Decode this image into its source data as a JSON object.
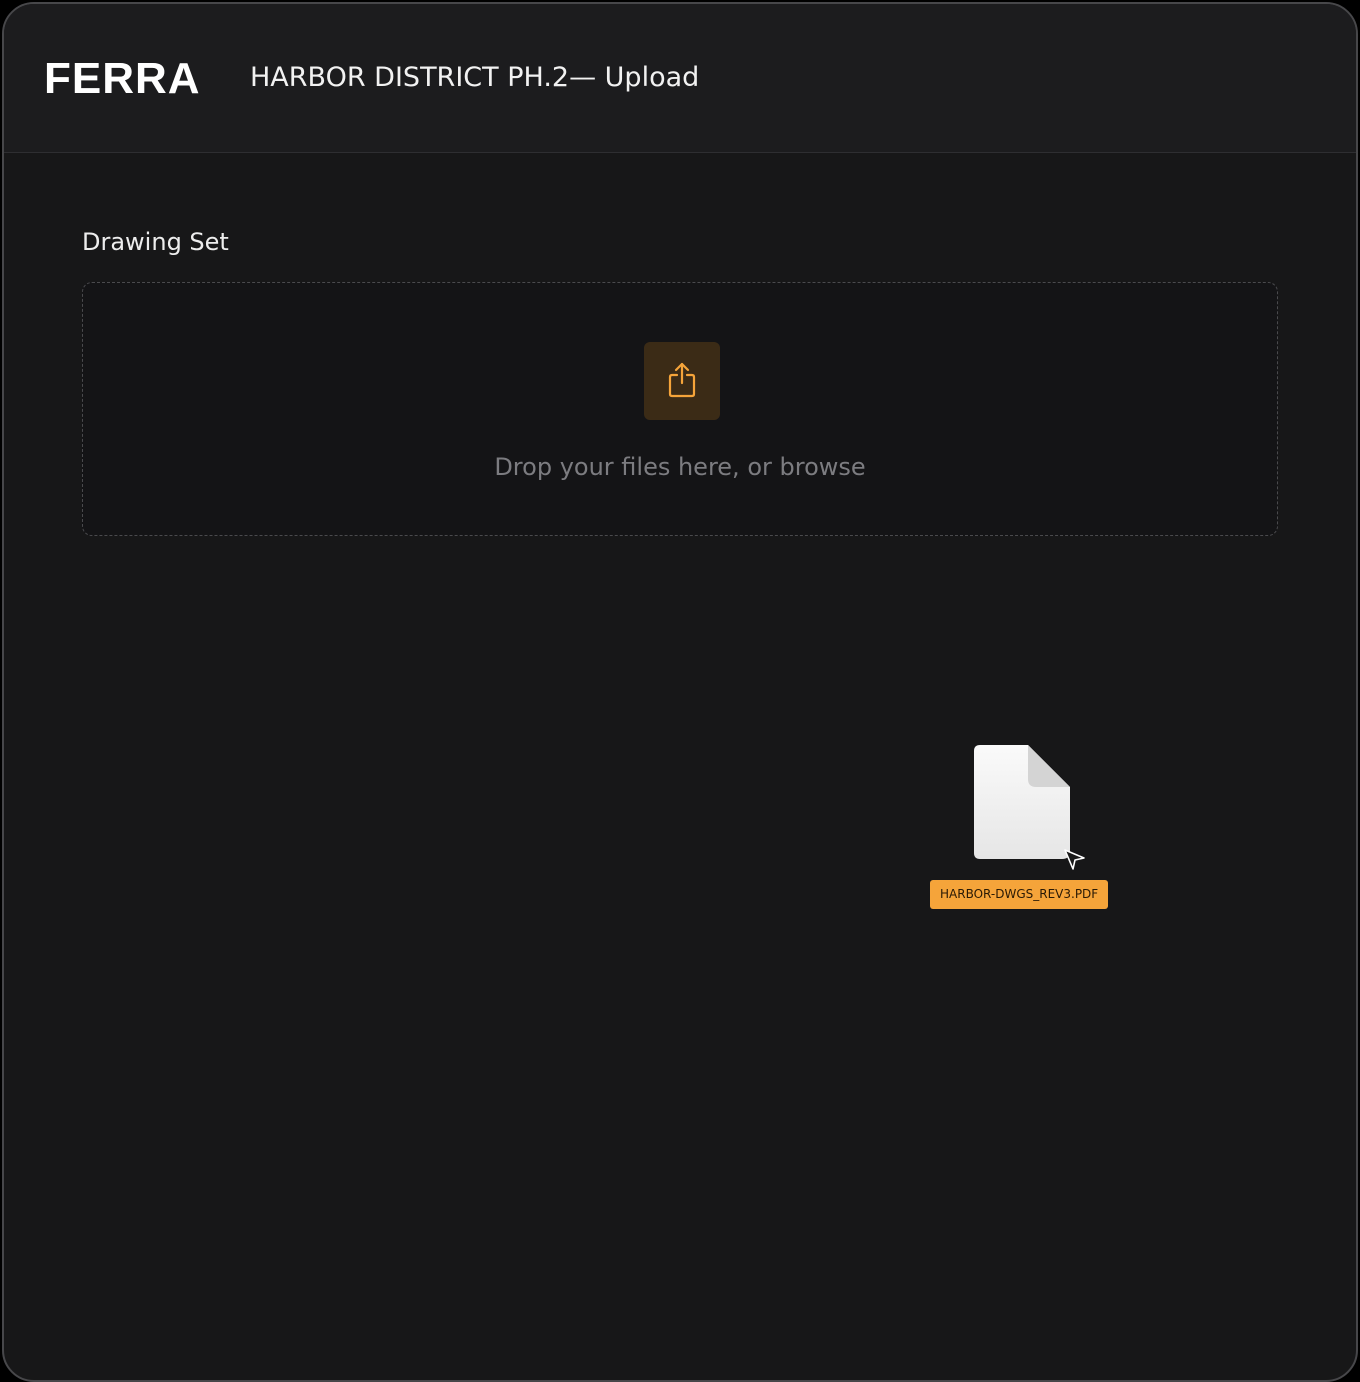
{
  "header": {
    "logo": "FERRA",
    "title": "HARBOR DISTRICT PH.2— Upload"
  },
  "main": {
    "section_label": "Drawing Set",
    "dropzone": {
      "icon": "upload-share-icon",
      "prompt": "Drop your files here, or browse"
    },
    "drag": {
      "file_icon": "document-icon",
      "cursor_icon": "pointer-cursor-icon",
      "file_name": "HARBOR-DWGS_REV3.PDF"
    }
  },
  "colors": {
    "background": "#171718",
    "header": "#1c1c1e",
    "accent": "#f5a43a",
    "tile": "#3b2b16"
  }
}
